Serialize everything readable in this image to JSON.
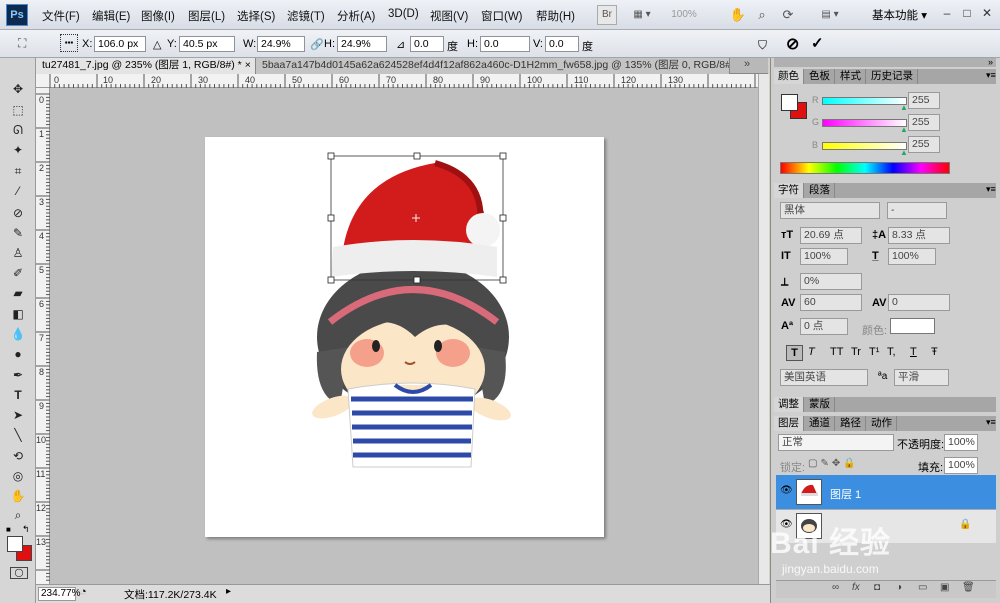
{
  "app": {
    "logo": "Ps"
  },
  "menubar": {
    "items": [
      "文件(F)",
      "编辑(E)",
      "图像(I)",
      "图层(L)",
      "选择(S)",
      "滤镜(T)",
      "分析(A)",
      "3D(D)",
      "视图(V)",
      "窗口(W)",
      "帮助(H)"
    ],
    "bridge": "Br",
    "zoom": "100%",
    "workspace": "基本功能",
    "win_buttons": [
      "–",
      "□",
      "✕"
    ]
  },
  "options": {
    "x_label": "X:",
    "x_value": "106.0 px",
    "y_label": "Y:",
    "y_value": "40.5 px",
    "w_label": "W:",
    "w_value": "24.9%",
    "h_label": "H:",
    "h_value": "24.9%",
    "rot_value": "0.0",
    "rot_unit": "度",
    "hskew_label": "H:",
    "hskew_value": "0.0",
    "hskew_unit": "度",
    "vskew_label": "V:",
    "vskew_value": "0.0",
    "cancel": "⊘",
    "commit": "✓"
  },
  "doc_tabs": [
    {
      "label": "tu27481_7.jpg @ 235% (图层 1, RGB/8#) *",
      "close": "×"
    },
    {
      "label": "5baa7a147b4d0145a62a624528ef4d4f12af862a460c-D1H2mm_fw658.jpg @ 135% (图层 0, RGB/8#) *",
      "close": "×"
    }
  ],
  "ruler_h": [
    "0",
    "10",
    "20",
    "30",
    "40",
    "50",
    "60",
    "70",
    "80",
    "90",
    "100",
    "110",
    "120",
    "130"
  ],
  "ruler_v": [
    "0",
    "1",
    "2",
    "3",
    "4",
    "5",
    "6",
    "7",
    "8",
    "9",
    "10",
    "11",
    "12",
    "13"
  ],
  "status": {
    "zoom": "234.77%",
    "doc": "文档:117.2K/273.4K"
  },
  "color_panel": {
    "tabs": [
      "颜色",
      "色板",
      "样式",
      "历史记录"
    ],
    "r_label": "R",
    "g_label": "G",
    "b_label": "B",
    "r": "255",
    "g": "255",
    "b": "255",
    "fg_color": "#ffffff",
    "bg_color": "#e01010"
  },
  "char_panel": {
    "tabs": [
      "字符",
      "段落"
    ],
    "font": "黑体",
    "style": "-",
    "size": "20.69 点",
    "leading": "8.33 点",
    "v_scale": "100%",
    "h_scale": "100%",
    "baseline": "0%",
    "tracking": "0",
    "kerning": "60",
    "shift": "0 点",
    "color_label": "颜色:",
    "style_buttons": [
      "T",
      "T",
      "TT",
      "Tr",
      "T¹",
      "T,",
      "T",
      "Ŧ"
    ],
    "language": "美国英语",
    "aa_label": "ªa",
    "antialias": "平滑"
  },
  "adjust_panel": {
    "tabs": [
      "调整",
      "蒙版"
    ]
  },
  "layers_panel": {
    "tabs": [
      "图层",
      "通道",
      "路径",
      "动作"
    ],
    "blend": "正常",
    "opacity_label": "不透明度:",
    "opacity": "100%",
    "lock_label": "锁定:",
    "fill_label": "填充:",
    "fill": "100%",
    "layers": [
      {
        "name": "图层 1",
        "selected": true
      },
      {
        "name": "",
        "selected": false
      }
    ],
    "footer_icons": [
      "∞",
      "fx",
      "◘",
      "◑",
      "▭",
      "▣",
      "🗑"
    ]
  },
  "watermark": {
    "text": "Bai 经验",
    "url": "jingyan.baidu.com"
  }
}
